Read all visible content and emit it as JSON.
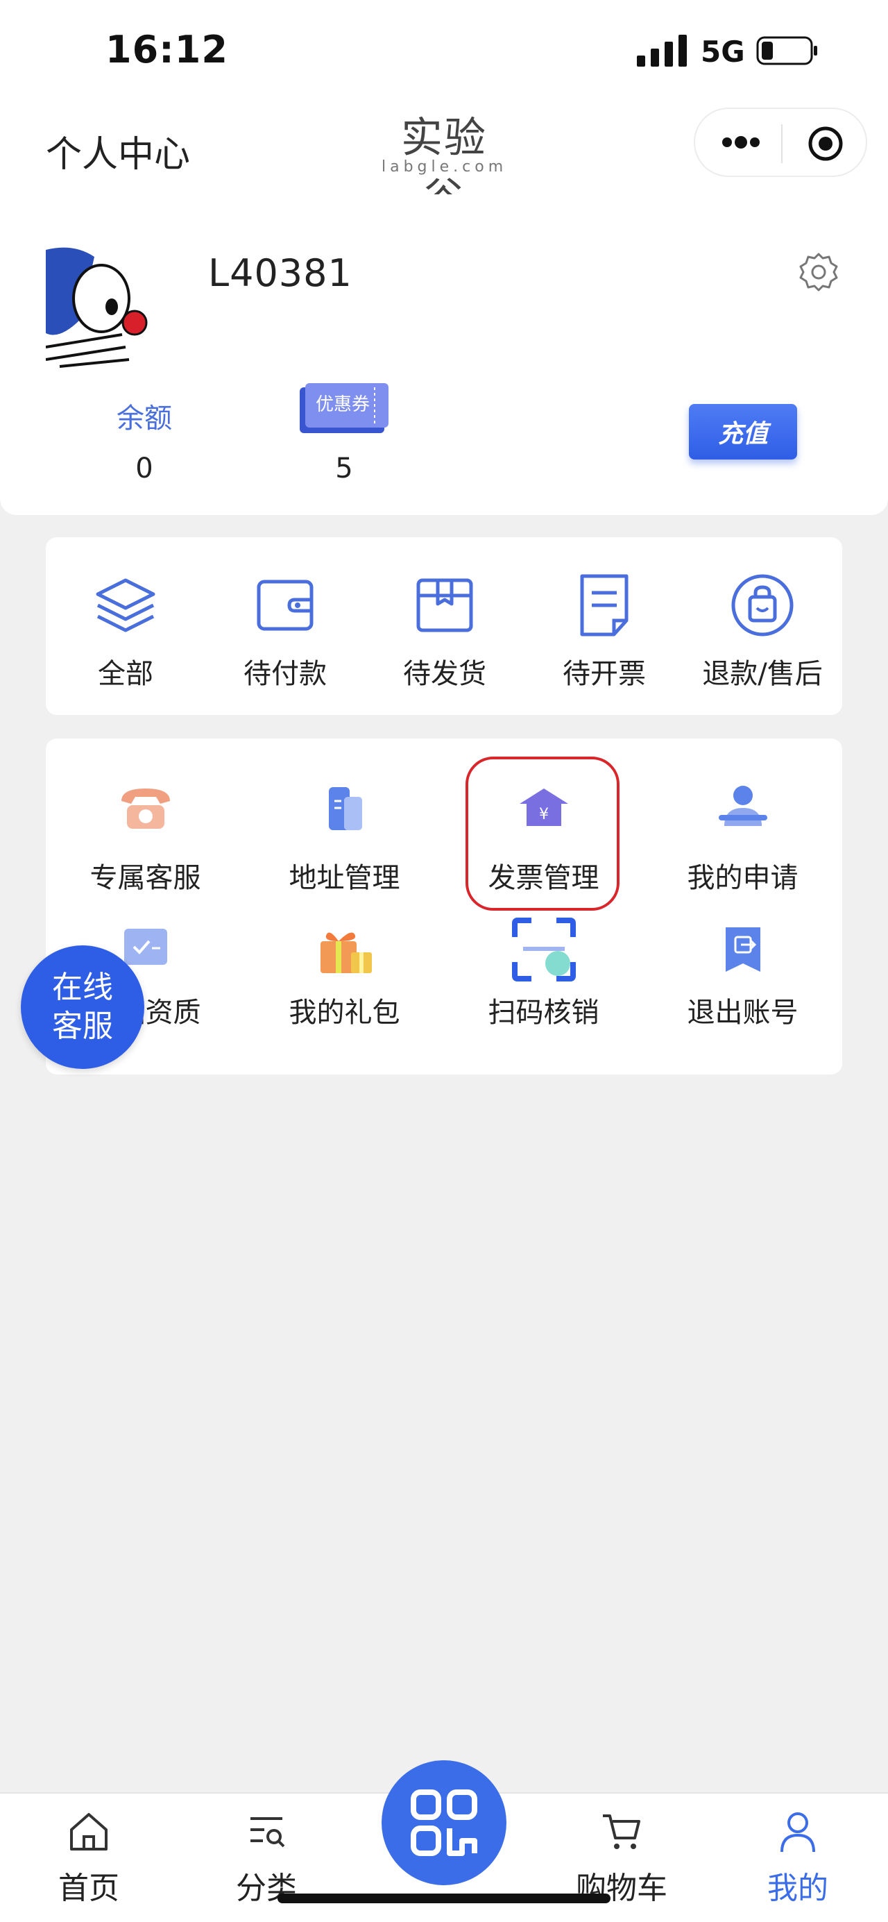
{
  "status_bar": {
    "time": "16:12",
    "network": "5G"
  },
  "header": {
    "title": "个人中心",
    "logo_text": "实验谷",
    "logo_sub": "labgle.com"
  },
  "profile": {
    "username": "L40381",
    "balance_label": "余额",
    "balance_value": "0",
    "coupon_label": "优惠券",
    "coupon_value": "5",
    "recharge_label": "充值"
  },
  "orders": [
    {
      "label": "全部",
      "icon": "layers-icon"
    },
    {
      "label": "待付款",
      "icon": "wallet-icon"
    },
    {
      "label": "待发货",
      "icon": "box-icon"
    },
    {
      "label": "待开票",
      "icon": "invoice-doc-icon"
    },
    {
      "label": "退款/售后",
      "icon": "shopping-bag-icon"
    }
  ],
  "services": [
    {
      "label": "专属客服",
      "icon": "telephone-icon"
    },
    {
      "label": "地址管理",
      "icon": "building-icon"
    },
    {
      "label": "发票管理",
      "icon": "invoice-house-icon"
    },
    {
      "label": "我的申请",
      "icon": "applicant-icon"
    },
    {
      "label": "产品资质",
      "icon": "certificate-icon"
    },
    {
      "label": "我的礼包",
      "icon": "gift-icon"
    },
    {
      "label": "扫码核销",
      "icon": "scan-icon"
    },
    {
      "label": "退出账号",
      "icon": "logout-icon"
    }
  ],
  "online_service": {
    "line1": "在线",
    "line2": "客服"
  },
  "tabbar": [
    {
      "label": "首页",
      "icon": "home-icon"
    },
    {
      "label": "分类",
      "icon": "category-search-icon"
    },
    {
      "label": "",
      "icon": "qr-code-icon"
    },
    {
      "label": "购物车",
      "icon": "cart-icon"
    },
    {
      "label": "我的",
      "icon": "user-icon",
      "active": true
    }
  ],
  "colors": {
    "accent": "#3b6de8",
    "highlight": "#d8262b",
    "background": "#f0f0f0"
  }
}
